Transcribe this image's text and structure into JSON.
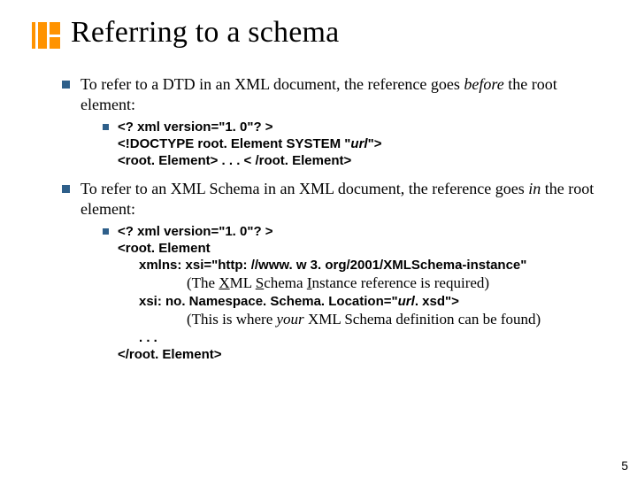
{
  "title": "Referring to a schema",
  "bullets": {
    "b1": {
      "pre": "To refer to a DTD in an XML document, the reference goes ",
      "em": "before",
      "post": " the root element:",
      "code": {
        "l1": "<? xml version=\"1. 0\"? >",
        "l2a": "<!DOCTYPE root. Element SYSTEM \"",
        "l2b": "url",
        "l2c": "\">",
        "l3": "<root. Element> . . . < /root. Element>"
      }
    },
    "b2": {
      "pre": "To refer to an XML Schema in an XML document, the reference goes ",
      "em": "in",
      "post": " the root element:",
      "code": {
        "l1": "<? xml version=\"1. 0\"? >",
        "l2": "<root. Element",
        "l3": "xmlns: xsi=\"http: //www. w 3. org/2001/XMLSchema-instance\"",
        "n1a": "(The ",
        "n1b": "X",
        "n1c": "ML ",
        "n1d": "S",
        "n1e": "chema ",
        "n1f": "I",
        "n1g": "nstance reference is required)",
        "l4a": "xsi: no. Namespace. Schema. Location=\"",
        "l4b": "url",
        "l4c": ". xsd\">",
        "n2a": "(This is where ",
        "n2b": "your",
        "n2c": " XML Schema definition can be found)",
        "l5": ". . .",
        "l6": "</root. Element>"
      }
    }
  },
  "page": "5"
}
